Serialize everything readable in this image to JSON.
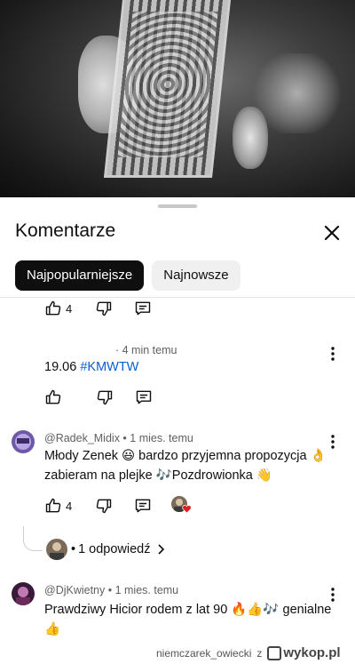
{
  "sheet": {
    "title": "Komentarze",
    "filters": [
      "Najpopularniejsze",
      "Najnowsze"
    ]
  },
  "comments": [
    {
      "likes": "4"
    },
    {
      "meta": "· 4 min temu",
      "text_plain": "19.06 ",
      "hashtag": "#KMWTW"
    },
    {
      "author": "@Radek_Midix",
      "time": "1 mies. temu",
      "meta": "@Radek_Midix • 1 mies. temu",
      "line1": "Młody Zenek 😃 bardzo przyjemna propozycja 👌",
      "line2": "zabieram na plejke 🎶Pozdrowionka 👋",
      "likes": "4",
      "replies_label": "1 odpowiedź"
    },
    {
      "author": "@DjKwietny",
      "time": "1 mies. temu",
      "meta": "@DjKwietny • 1 mies. temu",
      "line1": "Prawdziwy Hicior rodem z lat 90 🔥👍🎶 genialne",
      "line2": "👍"
    }
  ],
  "watermark": {
    "user": "niemczarek_owiecki",
    "sep": "z",
    "brand": "wykop.pl"
  },
  "colors": {
    "chip_active_bg": "#0f0f0f",
    "hashtag": "#065fd4",
    "meta_text": "#606060"
  }
}
